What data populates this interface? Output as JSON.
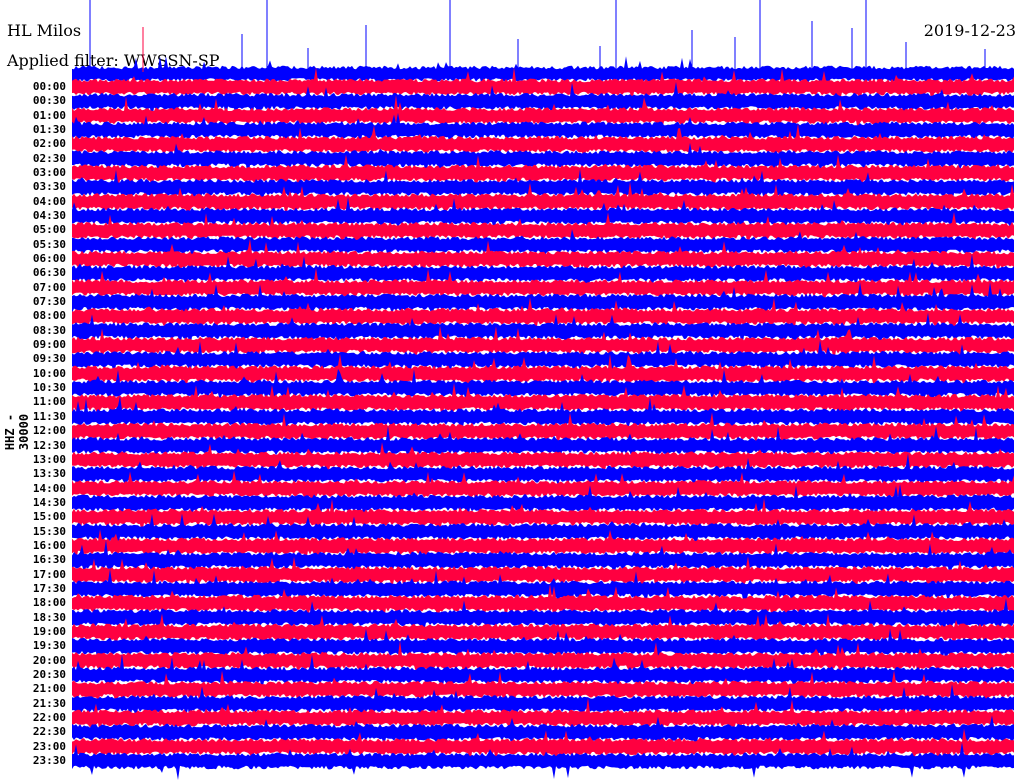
{
  "chart_data": {
    "type": "helicorder",
    "title": "HL Milos",
    "date": "2019-12-23",
    "filter_label": "Applied filter: WWSSN-SP",
    "channel_label": "HHZ - 30000",
    "row_interval_minutes": 30,
    "row_labels": [
      "00:00",
      "00:30",
      "01:00",
      "01:30",
      "02:00",
      "02:30",
      "03:00",
      "03:30",
      "04:00",
      "04:30",
      "05:00",
      "05:30",
      "06:00",
      "06:30",
      "07:00",
      "07:30",
      "08:00",
      "08:30",
      "09:00",
      "09:30",
      "10:00",
      "10:30",
      "11:00",
      "11:30",
      "12:00",
      "12:30",
      "13:00",
      "13:30",
      "14:00",
      "14:30",
      "15:00",
      "15:30",
      "16:00",
      "16:30",
      "17:00",
      "17:30",
      "18:00",
      "18:30",
      "19:00",
      "19:30",
      "20:00",
      "20:30",
      "21:00",
      "21:30",
      "22:00",
      "22:30",
      "23:00",
      "23:30"
    ],
    "trace_colors": [
      "#ff0040",
      "#0000ff"
    ]
  }
}
